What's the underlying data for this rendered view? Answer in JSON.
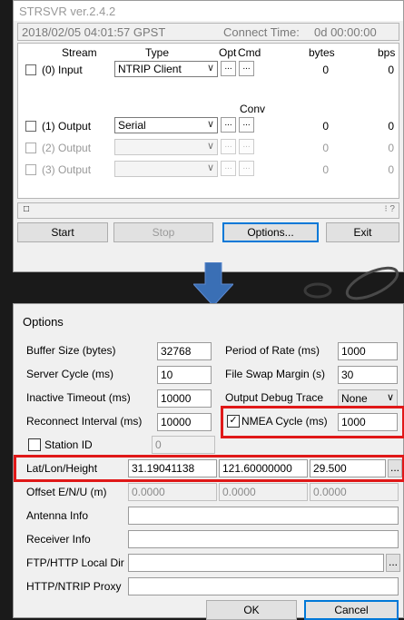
{
  "main": {
    "title": "STRSVR ver.2.4.2",
    "datetime": "2018/02/05 04:01:57 GPST",
    "connect_label": "Connect Time:",
    "connect_value": "0d 00:00:00",
    "headers": {
      "stream": "Stream",
      "type": "Type",
      "opt": "Opt",
      "cmd": "Cmd",
      "conv": "Conv",
      "bytes": "bytes",
      "bps": "bps"
    },
    "rows": [
      {
        "label": "(0) Input",
        "type": "NTRIP Client",
        "bytes": "0",
        "bps": "0"
      },
      {
        "label": "(1) Output",
        "type": "Serial",
        "bytes": "0",
        "bps": "0"
      },
      {
        "label": "(2) Output",
        "type": "",
        "bytes": "0",
        "bps": "0"
      },
      {
        "label": "(3) Output",
        "type": "",
        "bytes": "0",
        "bps": "0"
      }
    ],
    "buttons": {
      "start": "Start",
      "stop": "Stop",
      "options": "Options...",
      "exit": "Exit"
    },
    "dots": "...",
    "arrow": "∨",
    "status_box": "□",
    "status_right": "⁝ ?"
  },
  "options": {
    "title": "Options",
    "buffer_size_label": "Buffer Size (bytes)",
    "buffer_size": "32768",
    "period_rate_label": "Period of Rate (ms)",
    "period_rate": "1000",
    "server_cycle_label": "Server Cycle  (ms)",
    "server_cycle": "10",
    "file_swap_label": "File Swap Margin (s)",
    "file_swap": "30",
    "inactive_timeout_label": "Inactive Timeout (ms)",
    "inactive_timeout": "10000",
    "output_debug_label": "Output Debug Trace",
    "output_debug": "None",
    "reconnect_label": "Reconnect Interval  (ms)",
    "reconnect": "10000",
    "nmea_cycle_label": "NMEA Cycle (ms)",
    "nmea_cycle": "1000",
    "station_id_label": "Station ID",
    "station_id": "0",
    "latlon_label": "Lat/Lon/Height",
    "lat": "31.19041138",
    "lon": "121.60000000",
    "height": "29.500",
    "offset_label": "Offset E/N/U (m)",
    "offset_e": "0.0000",
    "offset_n": "0.0000",
    "offset_u": "0.0000",
    "antenna_label": "Antenna Info",
    "receiver_label": "Receiver Info",
    "ftp_label": "FTP/HTTP Local Dir",
    "proxy_label": "HTTP/NTRIP Proxy",
    "ok": "OK",
    "cancel": "Cancel",
    "check": "✓",
    "dots": "..."
  }
}
